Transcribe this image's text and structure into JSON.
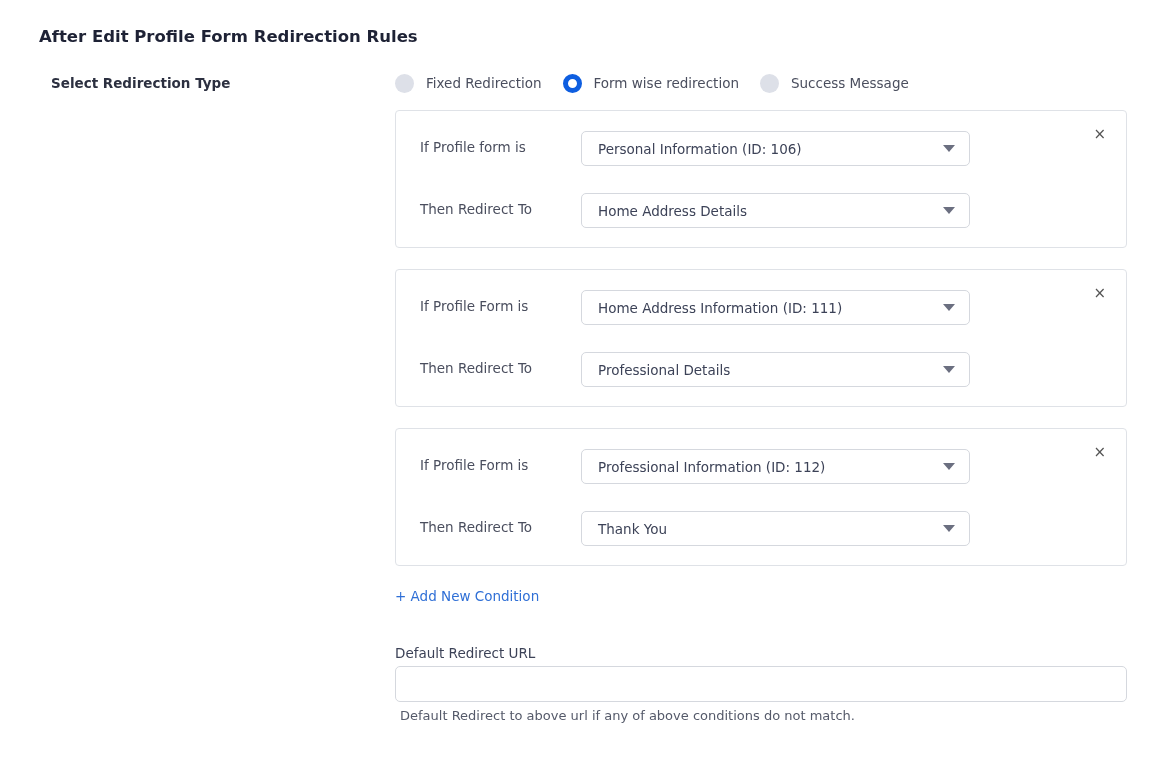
{
  "section_title": "After Edit Profile Form Redirection Rules",
  "redirection_type": {
    "label": "Select Redirection Type",
    "options": [
      {
        "label": "Fixed Redirection",
        "selected": false
      },
      {
        "label": "Form wise redirection",
        "selected": true
      },
      {
        "label": "Success Message",
        "selected": false
      }
    ]
  },
  "conditions": [
    {
      "if_label": "If Profile form is",
      "if_value": "Personal Information  (ID: 106)",
      "then_label": "Then Redirect To",
      "then_value": "Home Address Details",
      "remove": "×"
    },
    {
      "if_label": "If Profile Form is",
      "if_value": "Home Address Information (ID: 111)",
      "then_label": "Then Redirect To",
      "then_value": "Professional Details",
      "remove": "×"
    },
    {
      "if_label": "If Profile Form is",
      "if_value": "Professional Information (ID: 112)",
      "then_label": "Then Redirect To",
      "then_value": "Thank You",
      "remove": "×"
    }
  ],
  "add_condition": "+ Add New Condition",
  "default_url": {
    "label": "Default Redirect URL",
    "help": "Default Redirect to above url if any of above conditions do not match."
  }
}
